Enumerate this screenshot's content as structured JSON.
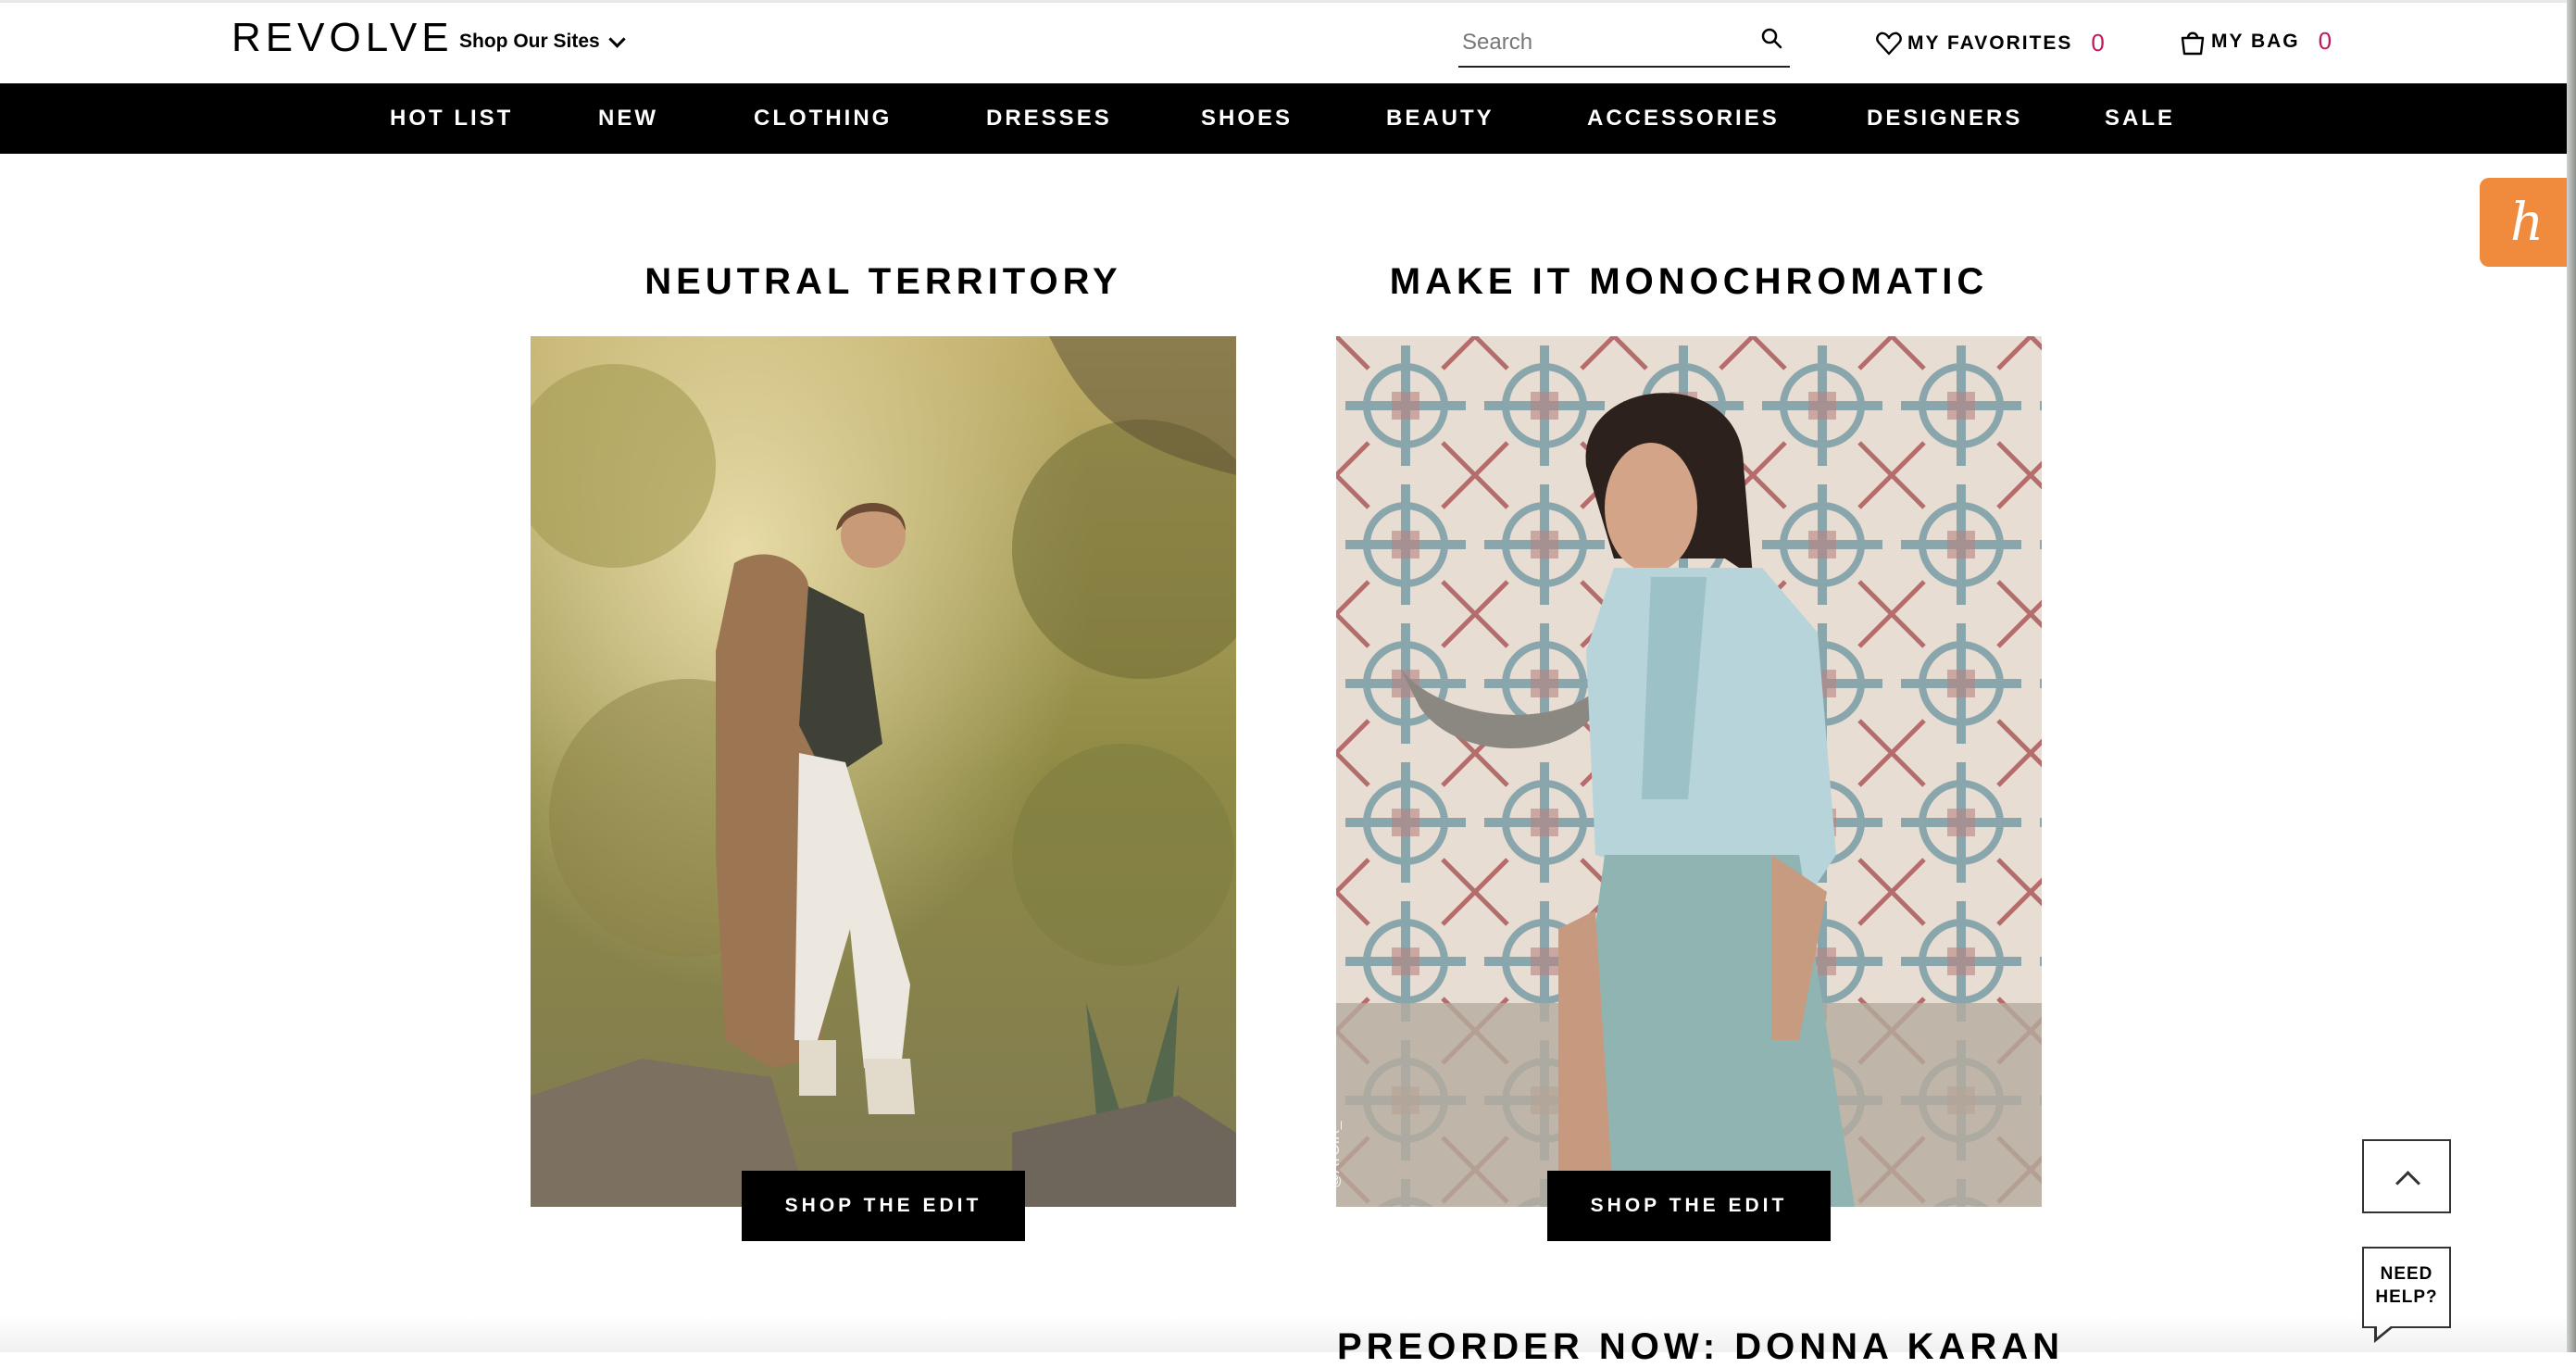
{
  "header": {
    "logo": "REVOLVE",
    "shop_sites": "Shop Our Sites",
    "search_placeholder": "Search",
    "favorites_label": "MY FAVORITES",
    "favorites_count": "0",
    "bag_label": "MY BAG",
    "bag_count": "0"
  },
  "nav": {
    "items": [
      {
        "label": "HOT LIST"
      },
      {
        "label": "NEW"
      },
      {
        "label": "CLOTHING"
      },
      {
        "label": "DRESSES"
      },
      {
        "label": "SHOES"
      },
      {
        "label": "BEAUTY"
      },
      {
        "label": "ACCESSORIES"
      },
      {
        "label": "DESIGNERS"
      },
      {
        "label": "SALE"
      }
    ]
  },
  "honey_widget": {
    "glyph": "h"
  },
  "edits": [
    {
      "title": "NEUTRAL TERRITORY",
      "cta": "SHOP THE EDIT"
    },
    {
      "title": "MAKE IT MONOCHROMATIC",
      "cta": "SHOP THE EDIT",
      "watermark": "@ATOIR_"
    }
  ],
  "next_section_title": "PREORDER NOW: DONNA KARAN",
  "help": {
    "line1": "NEED",
    "line2": "HELP?"
  },
  "colors": {
    "accent_count": "#c2185b",
    "nav_bg": "#000000",
    "honey": "#f08a3c"
  }
}
